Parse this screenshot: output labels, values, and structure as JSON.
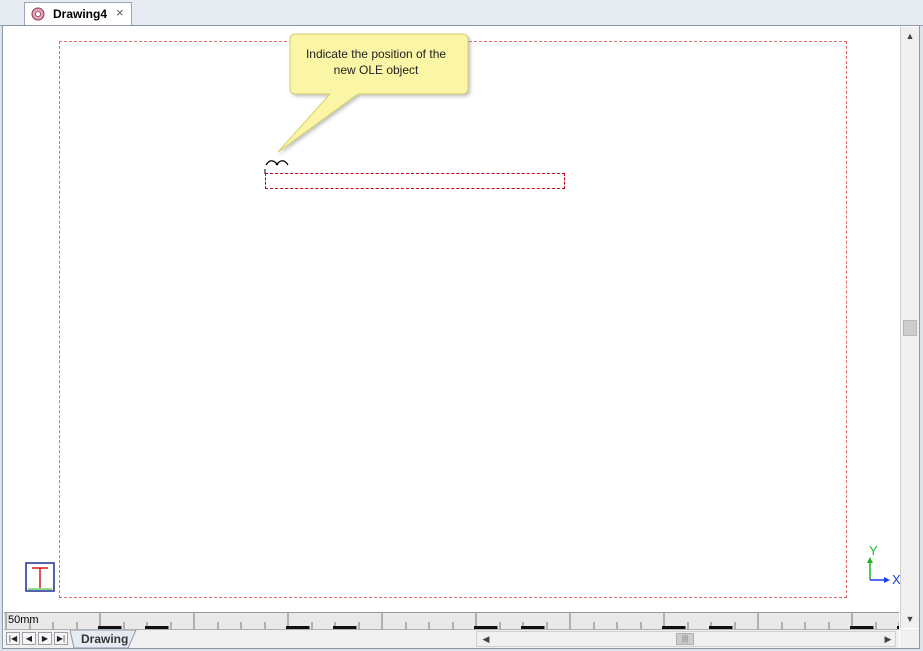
{
  "document_tab": {
    "title": "Drawing4",
    "close_glyph": "×",
    "icon": "drawing-document-icon"
  },
  "balloon": {
    "line1": "Indicate the position of the",
    "line2": "new OLE object",
    "fill": "#fbf6a6",
    "border": "#d7cf6a"
  },
  "axes": {
    "x_label": "X",
    "y_label": "Y",
    "x_color": "#1b3ff0",
    "y_color": "#1fb51f"
  },
  "ruler": {
    "scale_label": "50mm"
  },
  "sheet_tabs": [
    {
      "label": "Drawing"
    }
  ],
  "navigation": {
    "first": "first-sheet-icon",
    "prev": "previous-sheet-icon",
    "next": "next-sheet-icon",
    "last": "last-sheet-icon"
  },
  "colors": {
    "page_border": "#e36d6d",
    "ole_rect": "#c4001f"
  }
}
